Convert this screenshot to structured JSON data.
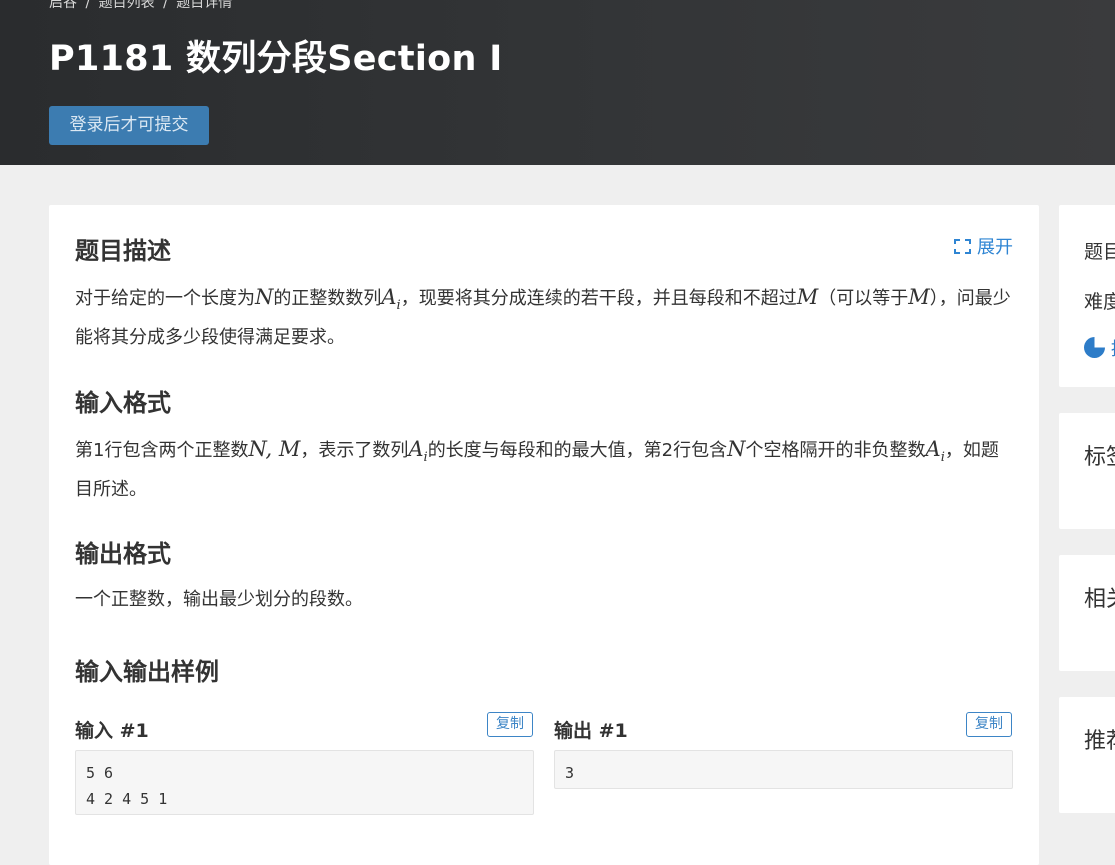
{
  "breadcrumb": {
    "home": "启谷",
    "list": "题目列表",
    "current": "题目详情",
    "sep": "/"
  },
  "problem_title": "P1181 数列分段Section I",
  "submit_label": "登录后才可提交",
  "expand_label": "展开",
  "description": {
    "heading": "题目描述",
    "t1": "对于给定的一个长度为",
    "v_n": "N",
    "t2": "的正整数数列",
    "v_a": "A",
    "v_i": "i",
    "t3": "，现要将其分成连续的若干段，并且每段和不超过",
    "v_m": "M",
    "t4": "（可以等于",
    "v_m2": "M",
    "t5": "），问最少能将其分成多少段使得满足要求。"
  },
  "input_format": {
    "heading": "输入格式",
    "t1": "第1行包含两个正整数",
    "v_nm": "N, M",
    "t2": "，表示了数列",
    "v_a": "A",
    "v_i": "i",
    "t3": "的长度与每段和的最大值，第2行包含",
    "v_n": "N",
    "t4": "个空格隔开的非负整数",
    "v_a2": "A",
    "v_i2": "i",
    "t5": "，如题目所述。"
  },
  "output_format": {
    "heading": "输出格式",
    "text": "一个正整数，输出最少划分的段数。"
  },
  "samples": {
    "heading": "输入输出样例",
    "input_label": "输入 #1",
    "output_label": "输出 #1",
    "copy_label": "复制",
    "input_value": "5 6\n4 2 4 5 1",
    "output_value": "3"
  },
  "sidebar": {
    "card1_line1": "题目",
    "card1_line2": "难度",
    "card1_icon_text": "提",
    "card2": "标签",
    "card3": "相关",
    "card4": "推荐"
  },
  "colors": {
    "accent": "#3c7cb1",
    "link": "#2f85d3",
    "header_bg": "#2f3133"
  }
}
